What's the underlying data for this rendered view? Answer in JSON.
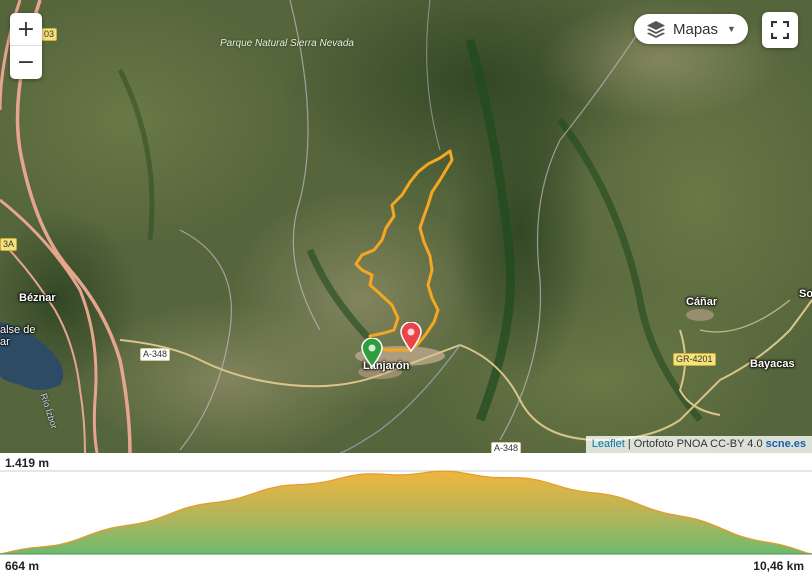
{
  "map": {
    "zoom_in": "+",
    "zoom_out": "−",
    "layers_button": {
      "label": "Mapas",
      "icon": "layers-icon"
    },
    "fullscreen_icon": "fullscreen-icon",
    "attribution": {
      "leaflet": "Leaflet",
      "sep": "|",
      "ortho": "Ortofoto PNOA CC-BY 4.0",
      "scne": "scne.es"
    },
    "park_label": "Parque Natural Sierra Nevada",
    "places": {
      "lanjaron": "Lanjarón",
      "beznar": "Béznar",
      "canar": "Cáñar",
      "bayacas": "Bayacas",
      "embalse": "alse de",
      "embalse2": "ar",
      "edge_right": "So",
      "rio": "Río Ízbor"
    },
    "roads": {
      "a348": "A-348",
      "a348b": "A-348",
      "gr4201": "GR-4201",
      "edge3a": "3A",
      "edge03": "03"
    },
    "markers": {
      "start_color": "#2e9e3e",
      "end_color": "#e8444a"
    },
    "track_color": "#f5a623"
  },
  "elevation_profile": {
    "y_max_label": "1.419 m",
    "y_min_label": "664 m",
    "x_max_label": "10,46 km",
    "elevation_max_m": 1419,
    "elevation_min_m": 664,
    "distance_km": 10.46
  }
}
